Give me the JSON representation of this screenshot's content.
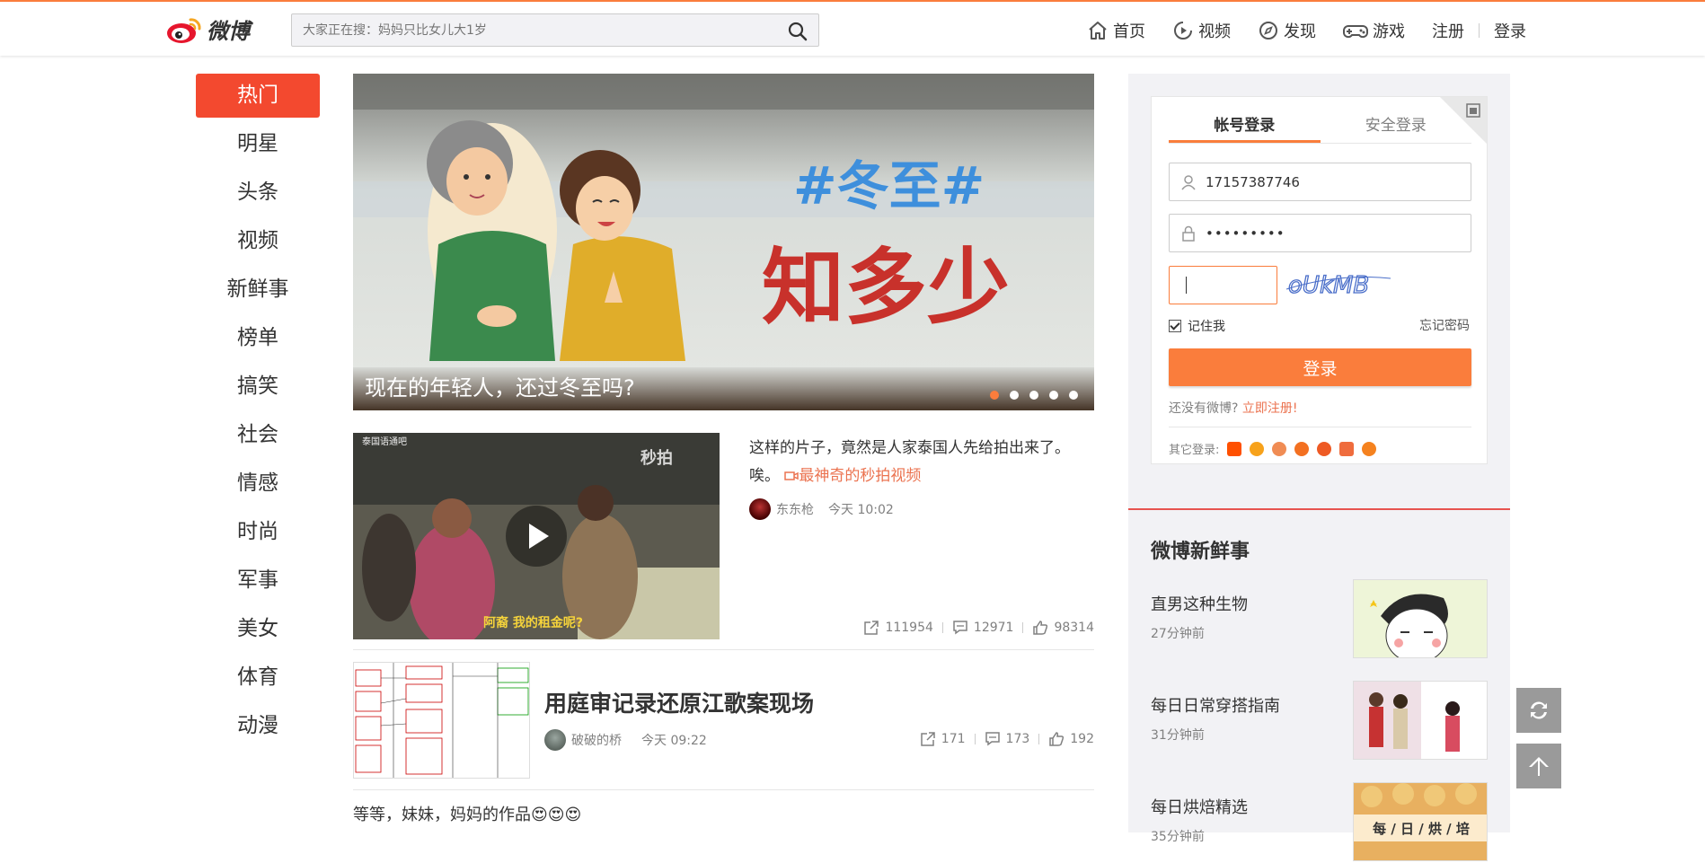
{
  "header": {
    "logo_text": "微博",
    "search_placeholder": "大家正在搜：妈妈只比女儿大1岁",
    "nav": [
      {
        "label": "首页",
        "icon": "home-icon"
      },
      {
        "label": "视频",
        "icon": "video-icon"
      },
      {
        "label": "发现",
        "icon": "compass-icon"
      },
      {
        "label": "游戏",
        "icon": "gamepad-icon"
      }
    ],
    "register": "注册",
    "login": "登录"
  },
  "leftnav": [
    "热门",
    "明星",
    "头条",
    "视频",
    "新鲜事",
    "榜单",
    "搞笑",
    "社会",
    "情感",
    "时尚",
    "军事",
    "美女",
    "体育",
    "动漫"
  ],
  "banner": {
    "caption": "现在的年轻人，还过冬至吗?",
    "art_title_1": "#冬至#",
    "art_title_2": "知多少",
    "dot_count": 5,
    "active_dot": 1
  },
  "feed": [
    {
      "text": "这样的片子，竟然是人家泰国人先给拍出来了。唉。",
      "link": "最神奇的秒拍视频",
      "author": "东东枪",
      "time": "今天 10:02",
      "shares": "111954",
      "comments": "12971",
      "likes": "98314",
      "thumb_watermark": "秒拍",
      "thumb_corner": "泰国语通吧",
      "thumb_subtitle": "阿裔 我的租金呢?"
    },
    {
      "title": "用庭审记录还原江歌案现场",
      "author": "破破的桥",
      "time": "今天 09:22",
      "shares": "171",
      "comments": "173",
      "likes": "192"
    },
    {
      "text": "等等，妹妹，妈妈的作品😍😍😍"
    }
  ],
  "login": {
    "tab_account": "帐号登录",
    "tab_secure": "安全登录",
    "username": "17157387746",
    "password": "•••••••••",
    "captcha_text": "oUkMB",
    "remember": "记住我",
    "forgot": "忘记密码",
    "button": "登录",
    "no_account": "还没有微博?",
    "register_now": "立即注册!",
    "other_login": "其它登录:"
  },
  "fresh": {
    "title": "微博新鲜事",
    "items": [
      {
        "title": "直男这种生物",
        "time": "27分钟前"
      },
      {
        "title": "每日日常穿搭指南",
        "time": "31分钟前"
      },
      {
        "title": "每日烘焙精选",
        "time": "35分钟前",
        "img_text": "每 / 日 / 烘 / 培"
      }
    ]
  },
  "colors": {
    "accent": "#fa7d3c",
    "hot_red": "#f3492f",
    "link": "#eb7350"
  }
}
